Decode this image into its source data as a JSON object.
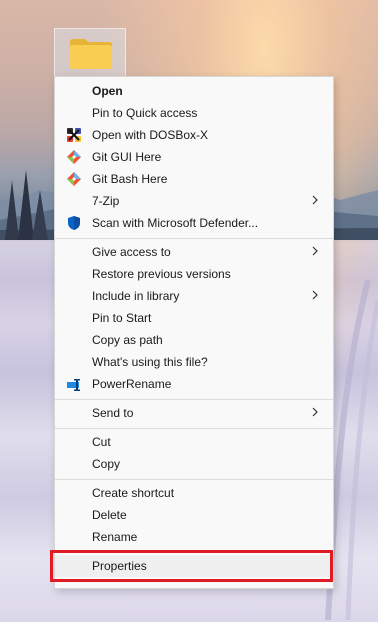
{
  "desktop": {
    "background": "snowy winter landscape at sunset"
  },
  "folder": {
    "icon": "folder-icon",
    "color": "#f8c94a"
  },
  "context_menu": {
    "items": [
      {
        "label": "Open",
        "bold": true,
        "icon": null
      },
      {
        "label": "Pin to Quick access",
        "icon": null
      },
      {
        "label": "Open with DOSBox-X",
        "icon": "dosbox-icon"
      },
      {
        "label": "Git GUI Here",
        "icon": "git-gui-icon"
      },
      {
        "label": "Git Bash Here",
        "icon": "git-bash-icon"
      },
      {
        "label": "7-Zip",
        "icon": null,
        "submenu": true
      },
      {
        "label": "Scan with Microsoft Defender...",
        "icon": "defender-shield-icon"
      },
      {
        "label": "Give access to",
        "icon": null,
        "submenu": true
      },
      {
        "label": "Restore previous versions",
        "icon": null
      },
      {
        "label": "Include in library",
        "icon": null,
        "submenu": true
      },
      {
        "label": "Pin to Start",
        "icon": null
      },
      {
        "label": "Copy as path",
        "icon": null
      },
      {
        "label": "What's using this file?",
        "icon": null
      },
      {
        "label": "PowerRename",
        "icon": "powerrename-icon"
      },
      {
        "label": "Send to",
        "icon": null,
        "submenu": true
      },
      {
        "label": "Cut",
        "icon": null
      },
      {
        "label": "Copy",
        "icon": null
      },
      {
        "label": "Create shortcut",
        "icon": null
      },
      {
        "label": "Delete",
        "icon": null
      },
      {
        "label": "Rename",
        "icon": null
      },
      {
        "label": "Properties",
        "icon": null,
        "highlighted": true
      }
    ]
  },
  "colors": {
    "menu_bg": "#f9f9f9",
    "highlight_border": "#e01b24",
    "defender_blue": "#0a63c9"
  }
}
